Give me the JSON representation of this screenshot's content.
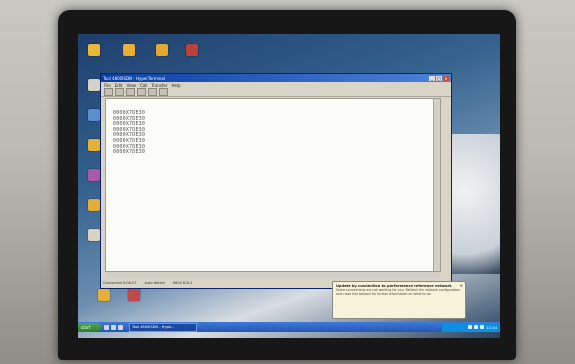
{
  "window": {
    "title": "Tool 4800ISDN - HyperTerminal",
    "menu": [
      "File",
      "Edit",
      "View",
      "Call",
      "Transfer",
      "Help"
    ]
  },
  "terminal": {
    "lines": [
      "0000X7DE30",
      "0000X7DE30",
      "0000X7DE30",
      "0000X7DE30",
      "0000X7DE30",
      "0000X7DE30",
      "0000X7DE30",
      "0000X7DE30"
    ]
  },
  "statusbar": {
    "connected": "Connected 0:08:27",
    "detect": "Auto detect",
    "settings": "9600 8-N-1"
  },
  "balloon": {
    "title": "Update by connection to performance reference network",
    "text": "Some connections are not working for you. Refresh the network configuration and close this balloon for further information on what to do."
  },
  "taskbar": {
    "start": "start",
    "task": "Tool 4800ISDN - Hype...",
    "clock": "12:34"
  },
  "colors": {
    "titlebar": "#0a3ea6",
    "taskbar": "#2457b5",
    "terminal_bg": "#fbfbf8"
  }
}
